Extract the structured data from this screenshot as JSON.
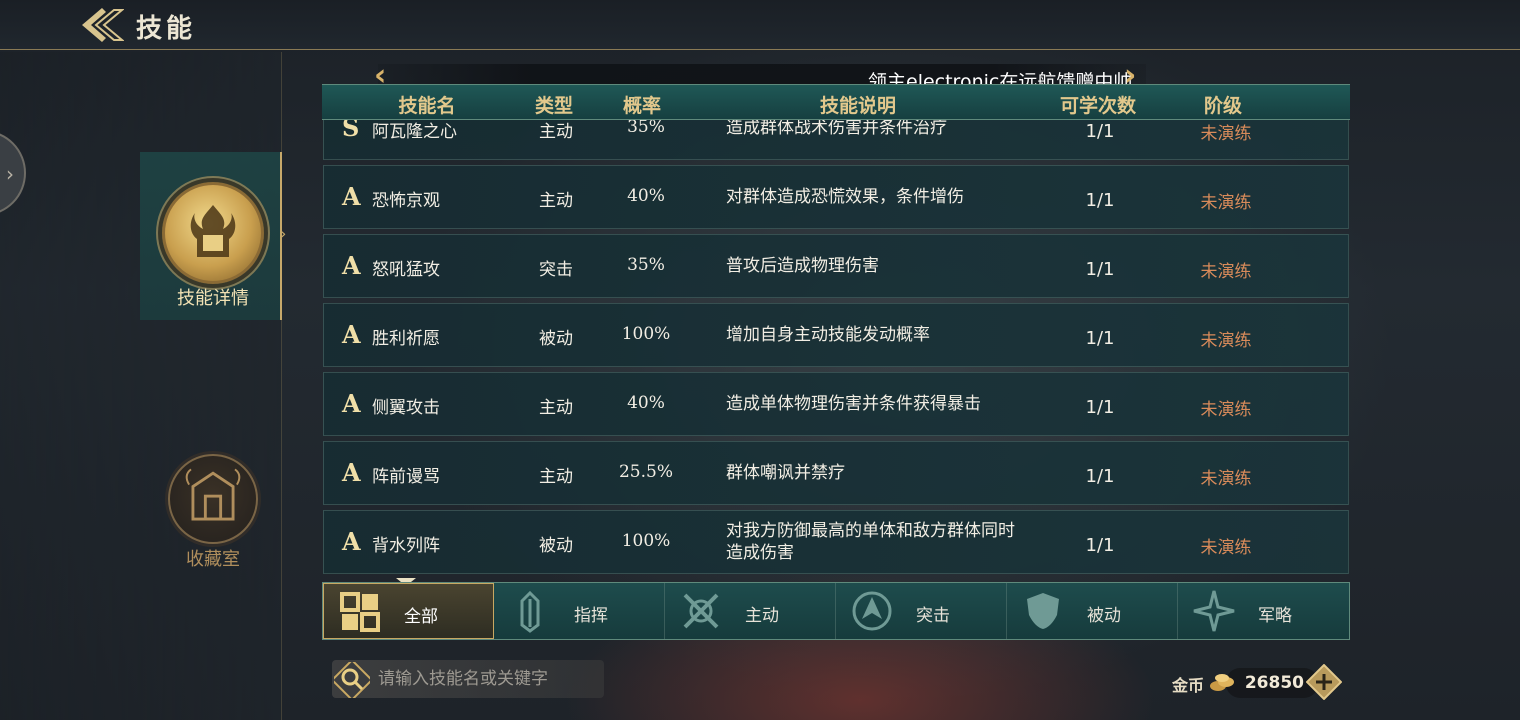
{
  "header": {
    "title": "技能"
  },
  "sidebar": {
    "items": [
      {
        "label": "技能详情",
        "active": true
      },
      {
        "label": "收藏室",
        "active": false
      }
    ]
  },
  "ticker": {
    "text": "领主electronic在远航馈赠中帅"
  },
  "table": {
    "columns": [
      "技能名",
      "类型",
      "概率",
      "技能说明",
      "可学次数",
      "阶级"
    ],
    "rows": [
      {
        "grade": "S",
        "name": "阿瓦隆之心",
        "type": "主动",
        "rate": "35%",
        "desc": "造成群体战术伤害并条件治疗",
        "count": "1/1",
        "stage": "未演练"
      },
      {
        "grade": "A",
        "name": "恐怖京观",
        "type": "主动",
        "rate": "40%",
        "desc": "对群体造成恐慌效果，条件增伤",
        "count": "1/1",
        "stage": "未演练"
      },
      {
        "grade": "A",
        "name": "怒吼猛攻",
        "type": "突击",
        "rate": "35%",
        "desc": "普攻后造成物理伤害",
        "count": "1/1",
        "stage": "未演练"
      },
      {
        "grade": "A",
        "name": "胜利祈愿",
        "type": "被动",
        "rate": "100%",
        "desc": "增加自身主动技能发动概率",
        "count": "1/1",
        "stage": "未演练"
      },
      {
        "grade": "A",
        "name": "侧翼攻击",
        "type": "主动",
        "rate": "40%",
        "desc": "造成单体物理伤害并条件获得暴击",
        "count": "1/1",
        "stage": "未演练"
      },
      {
        "grade": "A",
        "name": "阵前谩骂",
        "type": "主动",
        "rate": "25.5%",
        "desc": "群体嘲讽并禁疗",
        "count": "1/1",
        "stage": "未演练"
      },
      {
        "grade": "A",
        "name": "背水列阵",
        "type": "被动",
        "rate": "100%",
        "desc": "对我方防御最高的单体和敌方群体同时造成伤害",
        "count": "1/1",
        "stage": "未演练"
      }
    ]
  },
  "filters": [
    {
      "label": "全部",
      "icon": "grid-icon",
      "active": true
    },
    {
      "label": "指挥",
      "icon": "command-icon",
      "active": false
    },
    {
      "label": "主动",
      "icon": "active-icon",
      "active": false
    },
    {
      "label": "突击",
      "icon": "assault-icon",
      "active": false
    },
    {
      "label": "被动",
      "icon": "passive-icon",
      "active": false
    },
    {
      "label": "军略",
      "icon": "strategy-icon",
      "active": false
    }
  ],
  "search": {
    "placeholder": "请输入技能名或关键字"
  },
  "currency": {
    "label": "金币",
    "value": "26850"
  },
  "colors": {
    "gold": "#e2c88c",
    "stage_text": "#d98b5a",
    "row_bg": "#1a3a40"
  }
}
